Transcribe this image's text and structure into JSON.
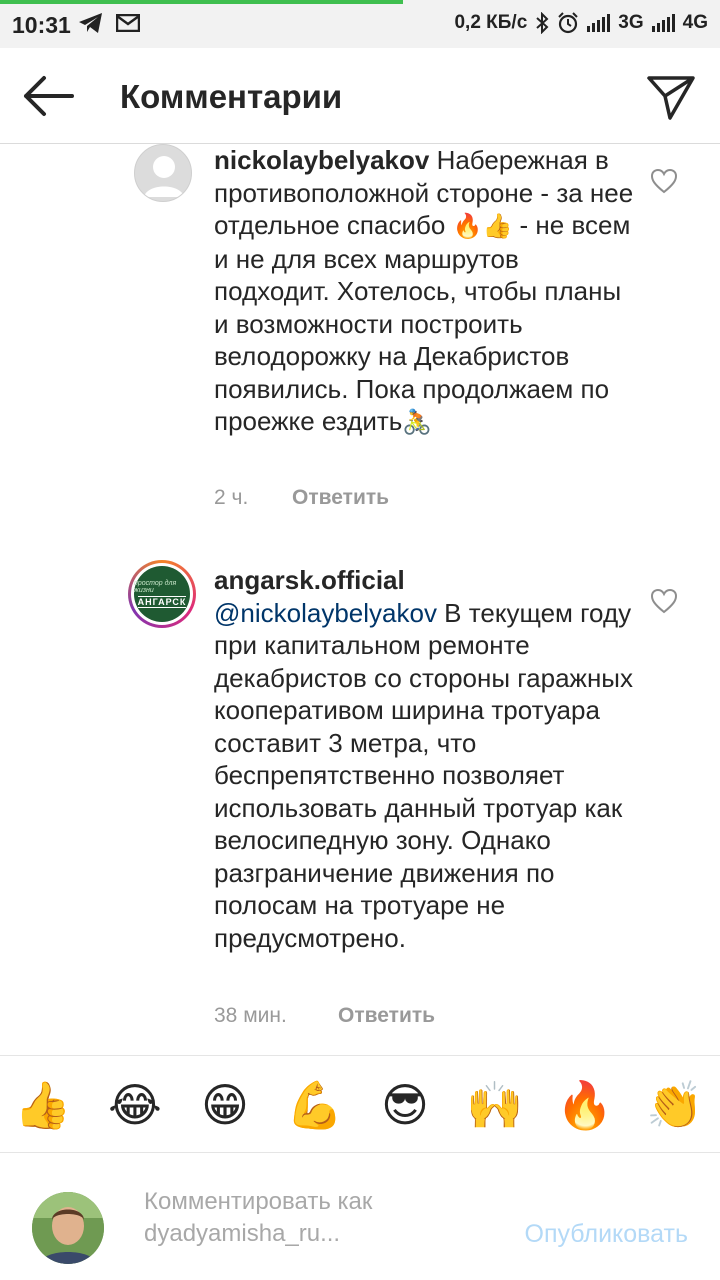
{
  "status_bar": {
    "time": "10:31",
    "speed": "0,2 КБ/с",
    "net1": "3G",
    "net2": "4G",
    "load_fraction": 0.56,
    "icons": [
      "telegram-icon",
      "mail-icon",
      "bluetooth-icon",
      "alarm-icon",
      "signal-icon"
    ]
  },
  "header": {
    "title": "Комментарии",
    "back_icon": "arrow-left-icon",
    "send_icon": "paper-plane-icon"
  },
  "comments": [
    {
      "username": "nickolaybelyakov",
      "text_part1": " Набережная в противоположной стороне - за нее отдельное спасибо ",
      "emoji1": "🔥👍",
      "text_part2": " - не всем и не для всех маршрутов подходит. Хотелось, чтобы планы и возможности построить велодорожку на Декабристов появились. Пока продолжаем по проежке ездить",
      "emoji2": "🚴",
      "time": "2 ч.",
      "reply": "Ответить"
    },
    {
      "username": "angarsk.official",
      "mention": "@nickolaybelyakov",
      "text": "  В текущем году при капитальном ремонте декабристов со стороны гаражных кооперативом ширина тротуара составит 3 метра, что беспрепятственно позволяет использовать данный тротуар как велосипедную зону. Однако разграничение движения по полосам на тротуаре не предусмотрено.",
      "avatar_logo_top": "простор для жизни",
      "avatar_logo_main": "АНГАРСК",
      "time": "38 мин.",
      "reply": "Ответить"
    }
  ],
  "emoji_bar": [
    "👍",
    "😂",
    "😁",
    "💪",
    "😎",
    "🙌",
    "🔥",
    "👏"
  ],
  "compose": {
    "placeholder": "Комментировать как dyadyamisha_ru...",
    "publish": "Опубликовать"
  },
  "colors": {
    "mention": "#003569",
    "publish_disabled": "#b3d9f7",
    "progress": "#3fbf4f"
  }
}
